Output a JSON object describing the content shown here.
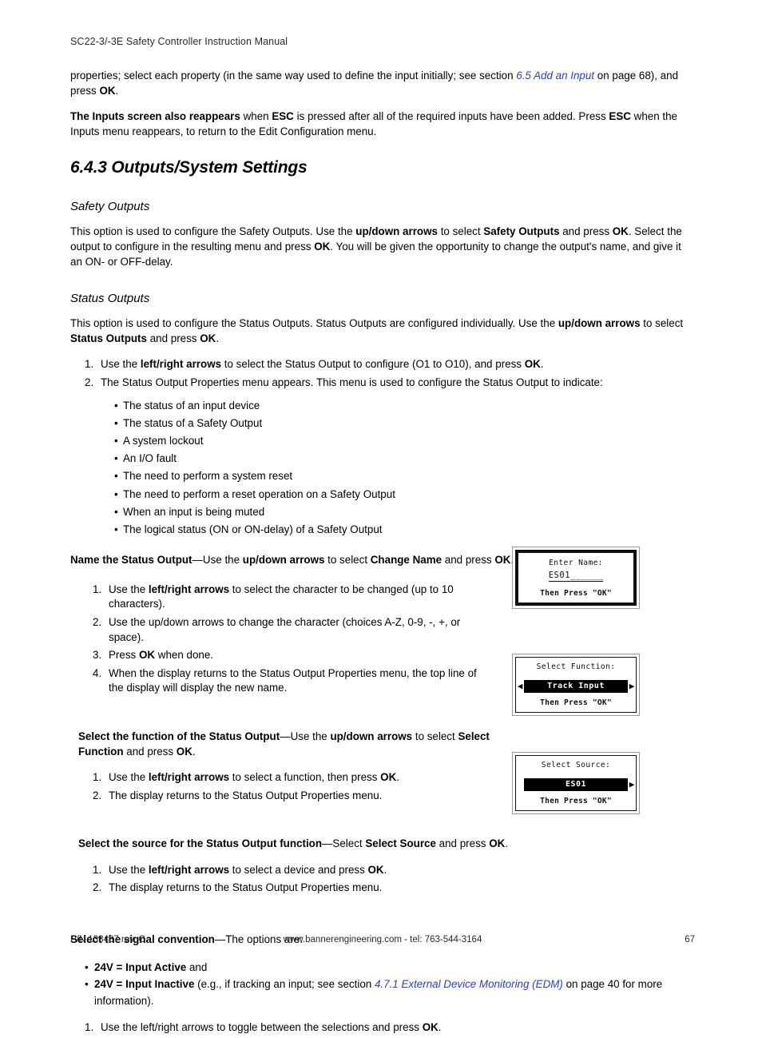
{
  "header": {
    "title": "SC22-3/-3E Safety Controller Instruction Manual"
  },
  "footer": {
    "part_number": "P/N 133487 rev. C",
    "center": "www.bannerengineering.com - tel: 763-544-3164",
    "page_number": "67"
  },
  "intro": {
    "para1_a": "properties; select each property (in the same way used to define the input initially; see section ",
    "para1_link": "6.5 Add an Input",
    "para1_b": " on page 68), and press ",
    "para1_ok": "OK",
    "para1_c": ".",
    "para2_bold": "The Inputs screen also reappears",
    "para2_a": " when ",
    "para2_esc1": "ESC",
    "para2_b": " is pressed after all of the required inputs have been added. Press ",
    "para2_esc2": "ESC",
    "para2_c": " when the Inputs menu reappears, to return to the Edit Configuration menu."
  },
  "section": {
    "number_title": "6.4.3 Outputs/System Settings"
  },
  "safety_outputs": {
    "heading": "Safety Outputs",
    "body_a": "This option is used to configure the Safety Outputs. Use the ",
    "body_b1": "up/down arrows",
    "body_c": " to select ",
    "body_b2": "Safety Outputs",
    "body_d": " and press ",
    "body_b3": "OK",
    "body_e": ". Select the output to configure in the resulting menu and press ",
    "body_b4": "OK",
    "body_f": ". You will be given the opportunity to change the output's name, and give it an ON- or OFF-delay."
  },
  "status_outputs": {
    "heading": "Status Outputs",
    "body_a": "This option is used to configure the Status Outputs. Status Outputs are configured individually. Use the ",
    "body_b1": "up/down arrows",
    "body_c": " to select ",
    "body_b2": "Status Outputs",
    "body_d": " and press ",
    "body_b3": "OK",
    "body_e": ".",
    "steps": [
      {
        "a": "Use the ",
        "bold": "left/right arrows",
        "b": " to select the Status Output to configure (O1 to O10), and press ",
        "bold2": "OK",
        "c": "."
      },
      {
        "a": "The Status Output Properties menu appears. This menu is used to configure the Status Output to indicate:",
        "bold": "",
        "b": "",
        "bold2": "",
        "c": ""
      }
    ],
    "indicate_bullets": [
      "The status of an input device",
      "The status of a Safety Output",
      "A system lockout",
      "An I/O fault",
      "The need to perform a system reset",
      "The need to perform a reset operation on a Safety Output",
      "When an input is being muted",
      "The logical status (ON or ON-delay) of a Safety Output"
    ]
  },
  "name_status_output": {
    "lead_bold": "Name the Status Output",
    "lead_a": "—Use the ",
    "lead_bold2": "up/down arrows",
    "lead_b": " to select ",
    "lead_bold3": "Change Name",
    "lead_c": " and press ",
    "lead_bold4": "OK",
    "lead_d": ".",
    "steps": [
      {
        "a": "Use the ",
        "bold": "left/right arrows",
        "b": " to select the character to be changed (up to 10 characters)."
      },
      {
        "a": "Use the up/down arrows to change the character (choices A-Z, 0-9, -, +, or space).",
        "bold": "",
        "b": ""
      },
      {
        "a": "Press ",
        "bold": "OK",
        "b": " when done."
      },
      {
        "a": "When the display returns to the Status Output Properties menu, the top line of the display will display the new name.",
        "bold": "",
        "b": ""
      }
    ],
    "lcd": {
      "title": "Enter Name:",
      "value": "ES01",
      "blanks": "______",
      "footer": "Then Press \"OK\""
    }
  },
  "select_function": {
    "lead_bold": "Select the function of the Status Output",
    "lead_a": "—Use the ",
    "lead_bold2": "up/down arrows",
    "lead_b": " to select ",
    "lead_bold3": "Select Function",
    "lead_c": " and press ",
    "lead_bold4": "OK",
    "lead_d": ".",
    "steps": [
      {
        "a": "Use the ",
        "bold": "left/right arrows",
        "b": " to select a function, then press ",
        "bold2": "OK",
        "c": "."
      },
      {
        "a": "The display returns to the Status Output Properties menu.",
        "bold": "",
        "b": "",
        "bold2": "",
        "c": ""
      }
    ],
    "lcd": {
      "title": "Select Function:",
      "left_arrow": "◀",
      "value": "Track Input",
      "right_arrow": "▶",
      "footer": "Then Press \"OK\""
    }
  },
  "select_source": {
    "lead_bold": "Select the source for the Status Output function",
    "lead_a": "—Select ",
    "lead_bold2": "Select Source",
    "lead_b": " and press ",
    "lead_bold3": "OK",
    "lead_c": ".",
    "steps": [
      {
        "a": "Use the ",
        "bold": "left/right arrows",
        "b": " to select a device and press ",
        "bold2": "OK",
        "c": "."
      },
      {
        "a": "The display returns to the Status Output Properties menu.",
        "bold": "",
        "b": "",
        "bold2": "",
        "c": ""
      }
    ],
    "lcd": {
      "title": "Select Source:",
      "left_arrow": " ",
      "value": "ES01",
      "right_arrow": "▶",
      "footer": "Then Press \"OK\""
    }
  },
  "signal_convention": {
    "lead_bold": "Select the signal convention",
    "lead_a": "—The options are:",
    "bullet1_bold": "24V = Input Active",
    "bullet1_rest": " and",
    "bullet2_bold": "24V = Input Inactive",
    "bullet2_a": " (e.g., if tracking an input; see section ",
    "bullet2_link": "4.7.1 External Device Monitoring (EDM)",
    "bullet2_b": " on page 40 for more information).",
    "steps": [
      {
        "a": "Use the left/right arrows to toggle between the selections and press ",
        "bold": "OK",
        "b": "."
      }
    ]
  }
}
